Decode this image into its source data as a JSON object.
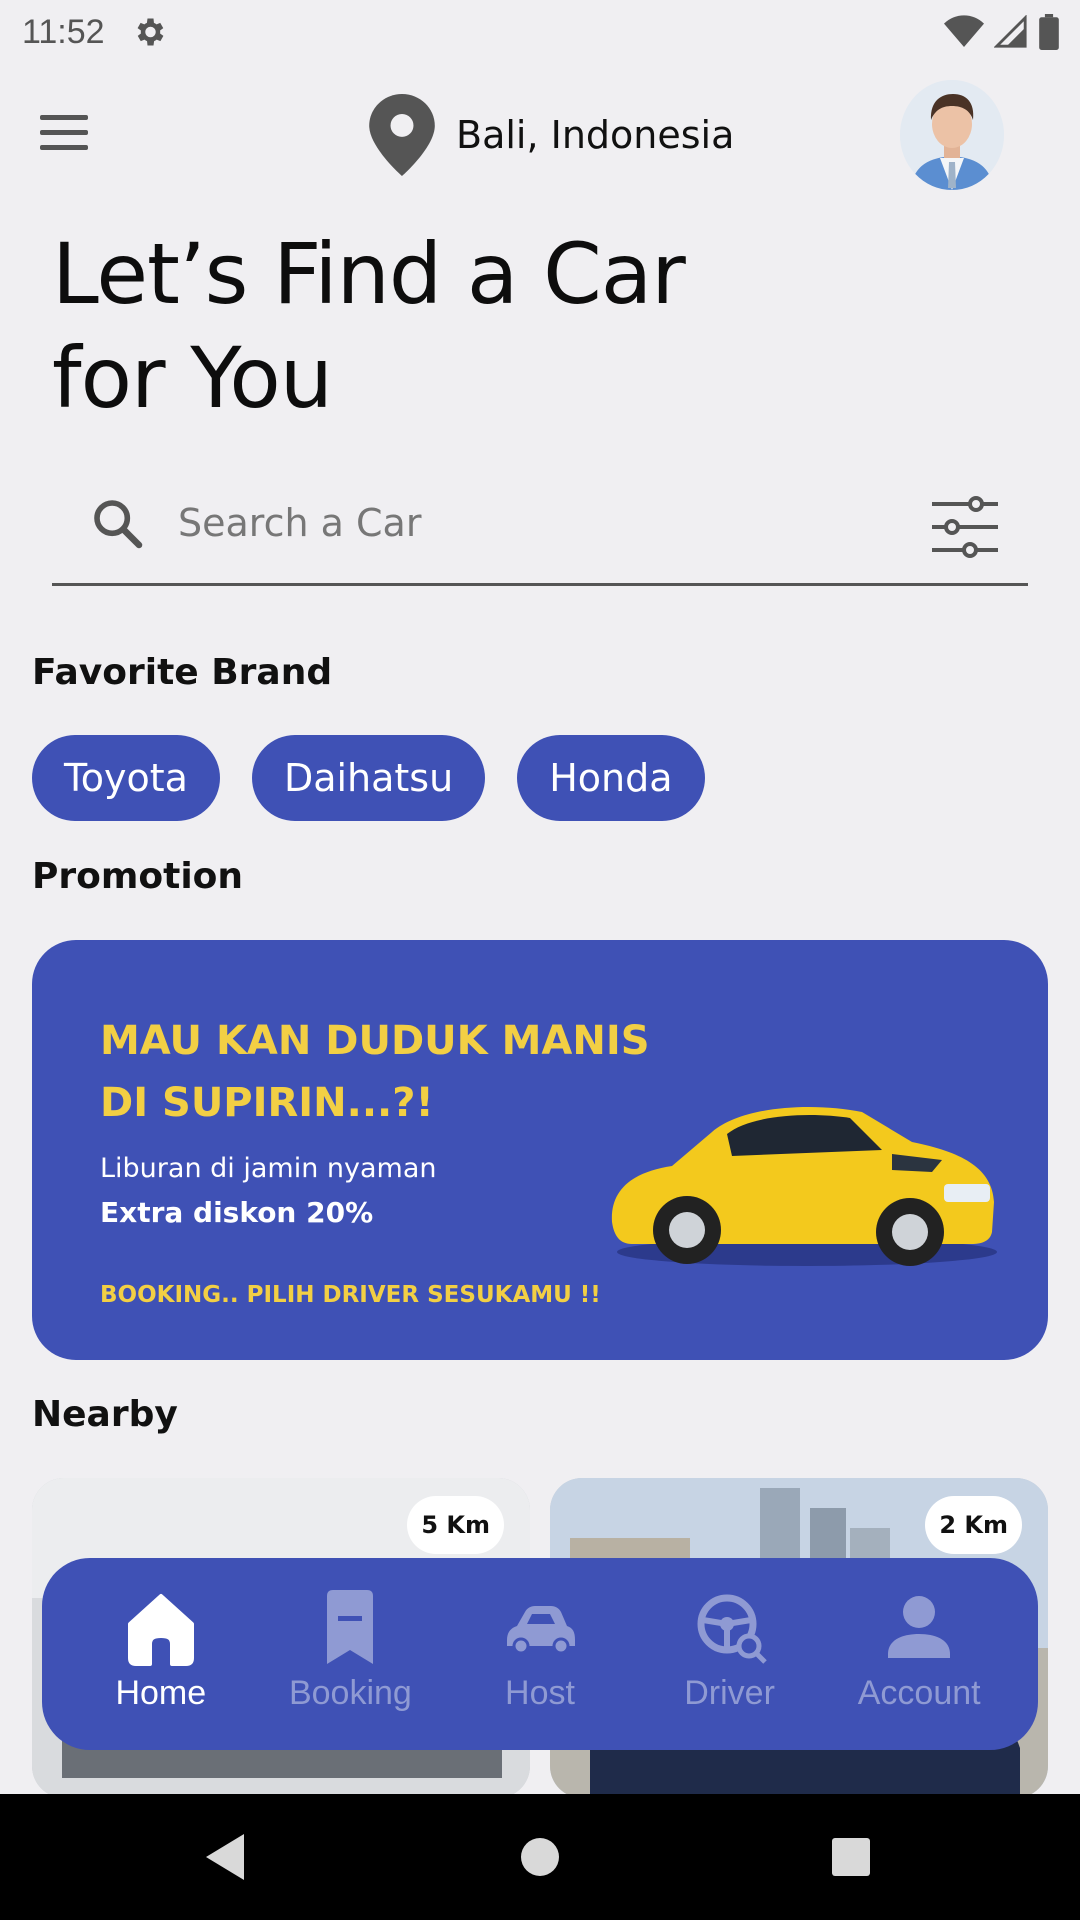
{
  "status_bar": {
    "time": "11:52"
  },
  "header": {
    "location": "Bali, Indonesia"
  },
  "title": {
    "line1": "Let’s Find a Car",
    "line2": "for You"
  },
  "search": {
    "placeholder": "Search a Car"
  },
  "favorite_brand": {
    "label": "Favorite Brand",
    "brands": [
      "Toyota",
      "Daihatsu",
      "Honda"
    ]
  },
  "promotion": {
    "label": "Promotion",
    "headline_line1": "MAU KAN DUDUK MANIS",
    "headline_line2": "DI SUPIRIN...?!",
    "sub1": "Liburan di jamin nyaman",
    "sub2": "Extra diskon 20%",
    "cta": "BOOKING.. PILIH DRIVER SESUKAMU !!"
  },
  "nearby": {
    "label": "Nearby",
    "cards": [
      {
        "distance": "5 Km"
      },
      {
        "distance": "2 Km"
      }
    ]
  },
  "bottom_nav": {
    "items": [
      {
        "label": "Home",
        "icon": "home-icon",
        "active": true
      },
      {
        "label": "Booking",
        "icon": "bookmark-icon",
        "active": false
      },
      {
        "label": "Host",
        "icon": "car-icon",
        "active": false
      },
      {
        "label": "Driver",
        "icon": "steering-wheel-icon",
        "active": false
      },
      {
        "label": "Account",
        "icon": "person-icon",
        "active": false
      }
    ]
  },
  "colors": {
    "primary": "#3f51b5",
    "promo_yellow": "#f2cf44",
    "background": "#f0eff2",
    "nav_inactive": "#8f9ad3"
  }
}
